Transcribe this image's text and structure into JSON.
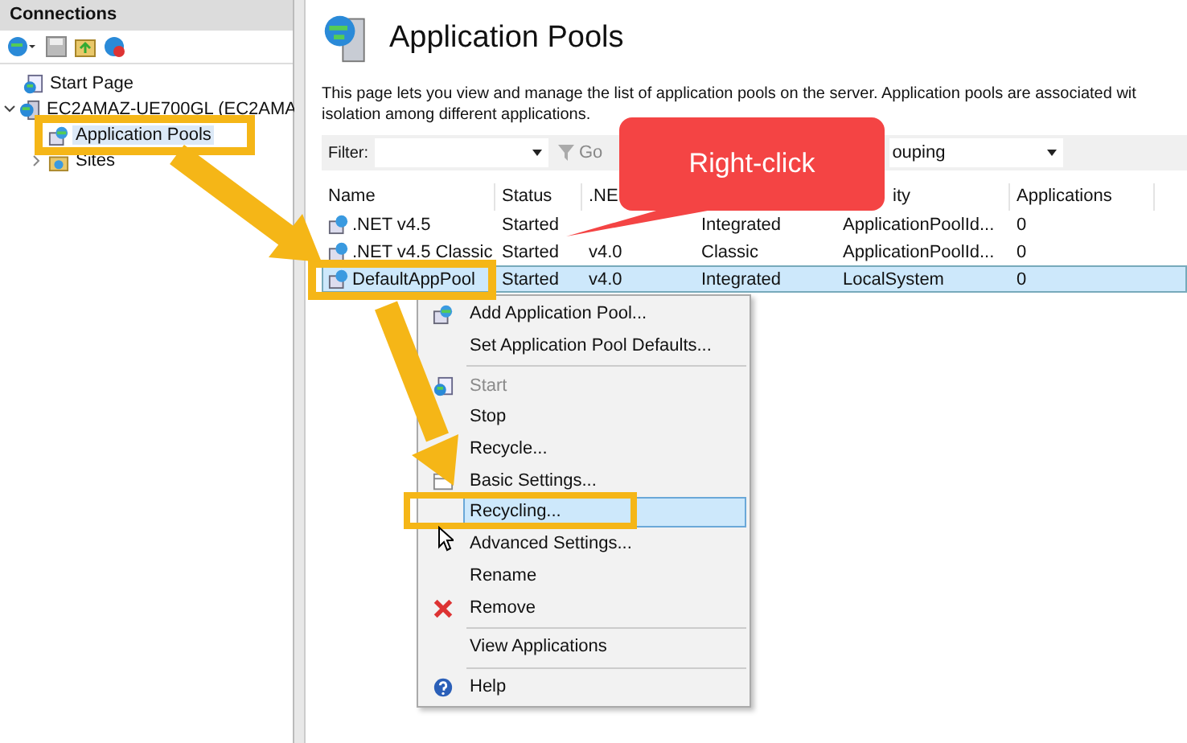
{
  "connections": {
    "title": "Connections",
    "tree": [
      {
        "label": "Start Page",
        "selected": false
      },
      {
        "label": "EC2AMAZ-UE700GL (EC2AMA",
        "expanded": true,
        "selected": false,
        "children": [
          {
            "label": "Application Pools",
            "selected": true
          },
          {
            "label": "Sites",
            "expanded": false,
            "selected": false
          }
        ]
      }
    ]
  },
  "page": {
    "title": "Application Pools",
    "description_lines": [
      "This page lets you view and manage the list of application pools on the server. Application pools are associated wit",
      "isolation among different applications."
    ]
  },
  "filter_bar": {
    "filter_label": "Filter:",
    "go_label": "Go",
    "group_by_value": "ouping"
  },
  "table": {
    "columns": [
      {
        "label": "Name"
      },
      {
        "label": "Status"
      },
      {
        "label": ".NE"
      },
      {},
      {
        "label": "ity"
      },
      {
        "label": "Applications"
      }
    ],
    "rows": [
      {
        "cells": [
          ".NET v4.5",
          "Started",
          null,
          "Integrated",
          "ApplicationPoolId...",
          "0"
        ],
        "selected": false
      },
      {
        "cells": [
          ".NET v4.5 Classic",
          "Started",
          "v4.0",
          "Classic",
          "ApplicationPoolId...",
          "0"
        ],
        "selected": false
      },
      {
        "cells": [
          "DefaultAppPool",
          "Started",
          "v4.0",
          "Integrated",
          "LocalSystem",
          "0"
        ],
        "selected": true
      }
    ]
  },
  "context_menu": {
    "items": [
      {
        "kind": "item",
        "label": "Add Application Pool...",
        "disabled": false,
        "selected": false
      },
      {
        "kind": "item",
        "label": "Set Application Pool Defaults...",
        "disabled": false,
        "selected": false
      },
      {
        "kind": "separator"
      },
      {
        "kind": "item",
        "label": "Start",
        "disabled": true,
        "selected": false
      },
      {
        "kind": "item",
        "label": "Stop",
        "disabled": false,
        "selected": false
      },
      {
        "kind": "item",
        "label": "Recycle...",
        "disabled": false,
        "selected": false
      },
      {
        "kind": "item",
        "label": "Basic Settings...",
        "disabled": false,
        "selected": false
      },
      {
        "kind": "item",
        "label": "Recycling...",
        "disabled": false,
        "selected": true
      },
      {
        "kind": "item",
        "label": "Advanced Settings...",
        "disabled": false,
        "selected": false
      },
      {
        "kind": "item",
        "label": "Rename",
        "disabled": false,
        "selected": false
      },
      {
        "kind": "item",
        "label": "Remove",
        "disabled": false,
        "selected": false
      },
      {
        "kind": "separator"
      },
      {
        "kind": "item",
        "label": "View Applications",
        "disabled": false,
        "selected": false
      },
      {
        "kind": "separator"
      },
      {
        "kind": "item",
        "label": "Help",
        "disabled": false,
        "selected": false
      }
    ]
  },
  "callout": {
    "label": "Right-click"
  }
}
